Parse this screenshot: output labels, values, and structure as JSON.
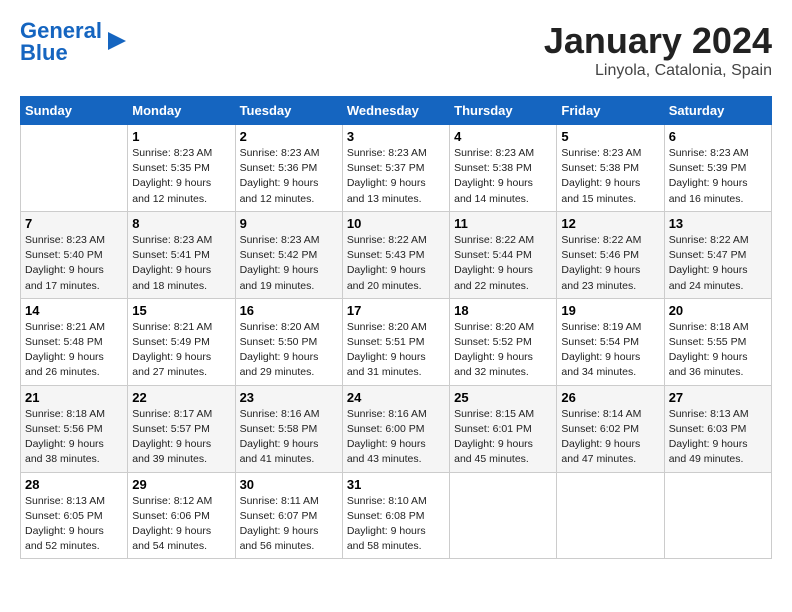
{
  "header": {
    "logo_line1": "General",
    "logo_line2": "Blue",
    "title": "January 2024",
    "subtitle": "Linyola, Catalonia, Spain"
  },
  "days_of_week": [
    "Sunday",
    "Monday",
    "Tuesday",
    "Wednesday",
    "Thursday",
    "Friday",
    "Saturday"
  ],
  "weeks": [
    [
      {
        "day": "",
        "info": ""
      },
      {
        "day": "1",
        "info": "Sunrise: 8:23 AM\nSunset: 5:35 PM\nDaylight: 9 hours\nand 12 minutes."
      },
      {
        "day": "2",
        "info": "Sunrise: 8:23 AM\nSunset: 5:36 PM\nDaylight: 9 hours\nand 12 minutes."
      },
      {
        "day": "3",
        "info": "Sunrise: 8:23 AM\nSunset: 5:37 PM\nDaylight: 9 hours\nand 13 minutes."
      },
      {
        "day": "4",
        "info": "Sunrise: 8:23 AM\nSunset: 5:38 PM\nDaylight: 9 hours\nand 14 minutes."
      },
      {
        "day": "5",
        "info": "Sunrise: 8:23 AM\nSunset: 5:38 PM\nDaylight: 9 hours\nand 15 minutes."
      },
      {
        "day": "6",
        "info": "Sunrise: 8:23 AM\nSunset: 5:39 PM\nDaylight: 9 hours\nand 16 minutes."
      }
    ],
    [
      {
        "day": "7",
        "info": "Sunrise: 8:23 AM\nSunset: 5:40 PM\nDaylight: 9 hours\nand 17 minutes."
      },
      {
        "day": "8",
        "info": "Sunrise: 8:23 AM\nSunset: 5:41 PM\nDaylight: 9 hours\nand 18 minutes."
      },
      {
        "day": "9",
        "info": "Sunrise: 8:23 AM\nSunset: 5:42 PM\nDaylight: 9 hours\nand 19 minutes."
      },
      {
        "day": "10",
        "info": "Sunrise: 8:22 AM\nSunset: 5:43 PM\nDaylight: 9 hours\nand 20 minutes."
      },
      {
        "day": "11",
        "info": "Sunrise: 8:22 AM\nSunset: 5:44 PM\nDaylight: 9 hours\nand 22 minutes."
      },
      {
        "day": "12",
        "info": "Sunrise: 8:22 AM\nSunset: 5:46 PM\nDaylight: 9 hours\nand 23 minutes."
      },
      {
        "day": "13",
        "info": "Sunrise: 8:22 AM\nSunset: 5:47 PM\nDaylight: 9 hours\nand 24 minutes."
      }
    ],
    [
      {
        "day": "14",
        "info": "Sunrise: 8:21 AM\nSunset: 5:48 PM\nDaylight: 9 hours\nand 26 minutes."
      },
      {
        "day": "15",
        "info": "Sunrise: 8:21 AM\nSunset: 5:49 PM\nDaylight: 9 hours\nand 27 minutes."
      },
      {
        "day": "16",
        "info": "Sunrise: 8:20 AM\nSunset: 5:50 PM\nDaylight: 9 hours\nand 29 minutes."
      },
      {
        "day": "17",
        "info": "Sunrise: 8:20 AM\nSunset: 5:51 PM\nDaylight: 9 hours\nand 31 minutes."
      },
      {
        "day": "18",
        "info": "Sunrise: 8:20 AM\nSunset: 5:52 PM\nDaylight: 9 hours\nand 32 minutes."
      },
      {
        "day": "19",
        "info": "Sunrise: 8:19 AM\nSunset: 5:54 PM\nDaylight: 9 hours\nand 34 minutes."
      },
      {
        "day": "20",
        "info": "Sunrise: 8:18 AM\nSunset: 5:55 PM\nDaylight: 9 hours\nand 36 minutes."
      }
    ],
    [
      {
        "day": "21",
        "info": "Sunrise: 8:18 AM\nSunset: 5:56 PM\nDaylight: 9 hours\nand 38 minutes."
      },
      {
        "day": "22",
        "info": "Sunrise: 8:17 AM\nSunset: 5:57 PM\nDaylight: 9 hours\nand 39 minutes."
      },
      {
        "day": "23",
        "info": "Sunrise: 8:16 AM\nSunset: 5:58 PM\nDaylight: 9 hours\nand 41 minutes."
      },
      {
        "day": "24",
        "info": "Sunrise: 8:16 AM\nSunset: 6:00 PM\nDaylight: 9 hours\nand 43 minutes."
      },
      {
        "day": "25",
        "info": "Sunrise: 8:15 AM\nSunset: 6:01 PM\nDaylight: 9 hours\nand 45 minutes."
      },
      {
        "day": "26",
        "info": "Sunrise: 8:14 AM\nSunset: 6:02 PM\nDaylight: 9 hours\nand 47 minutes."
      },
      {
        "day": "27",
        "info": "Sunrise: 8:13 AM\nSunset: 6:03 PM\nDaylight: 9 hours\nand 49 minutes."
      }
    ],
    [
      {
        "day": "28",
        "info": "Sunrise: 8:13 AM\nSunset: 6:05 PM\nDaylight: 9 hours\nand 52 minutes."
      },
      {
        "day": "29",
        "info": "Sunrise: 8:12 AM\nSunset: 6:06 PM\nDaylight: 9 hours\nand 54 minutes."
      },
      {
        "day": "30",
        "info": "Sunrise: 8:11 AM\nSunset: 6:07 PM\nDaylight: 9 hours\nand 56 minutes."
      },
      {
        "day": "31",
        "info": "Sunrise: 8:10 AM\nSunset: 6:08 PM\nDaylight: 9 hours\nand 58 minutes."
      },
      {
        "day": "",
        "info": ""
      },
      {
        "day": "",
        "info": ""
      },
      {
        "day": "",
        "info": ""
      }
    ]
  ]
}
